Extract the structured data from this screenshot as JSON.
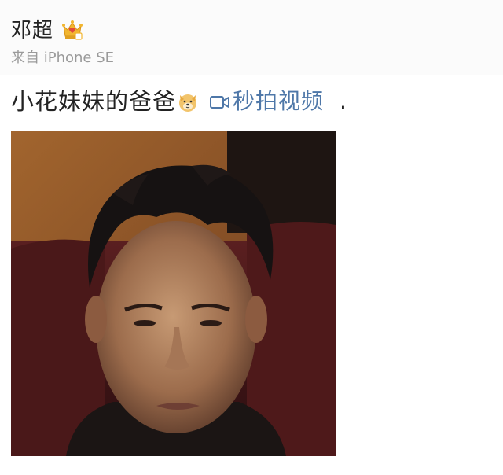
{
  "post": {
    "username": "邓超",
    "source": "来自 iPhone SE",
    "content_text": "小花妹妹的爸爸",
    "video_link_label": "秒拍视频",
    "trailing_text": "."
  },
  "icons": {
    "verified_badge": "crown-icon",
    "emoji": "dog-face-icon",
    "video_link": "video-camera-icon"
  },
  "colors": {
    "username": "#222222",
    "source": "#9a9a9a",
    "link": "#4e77a8",
    "crown_gold": "#f2b630",
    "crown_red": "#e24a3b"
  }
}
